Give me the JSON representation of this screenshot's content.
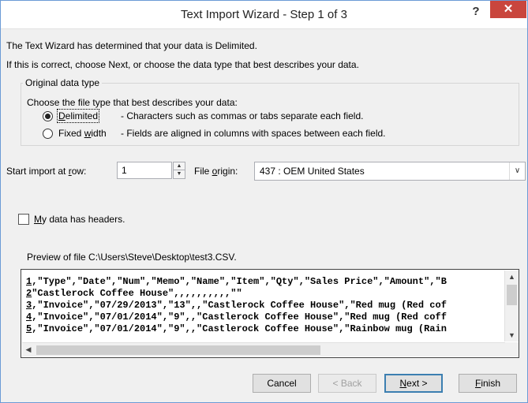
{
  "window": {
    "title": "Text Import Wizard - Step 1 of 3",
    "help_label": "?",
    "close_label": "✕"
  },
  "intro": {
    "line1": "The Text Wizard has determined that your data is Delimited.",
    "line2": "If this is correct, choose Next, or choose the data type that best describes your data."
  },
  "original_data_type": {
    "legend": "Original data type",
    "prompt": "Choose the file type that best describes your data:",
    "options": [
      {
        "label_pre": "",
        "label_key": "D",
        "label_post": "elimited",
        "description": "- Characters such as commas or tabs separate each field.",
        "checked": true
      },
      {
        "label_pre": "Fixed ",
        "label_key": "w",
        "label_post": "idth",
        "description": "- Fields are aligned in columns with spaces between each field.",
        "checked": false
      }
    ]
  },
  "start_import": {
    "label_pre": "Start import at ",
    "label_key": "r",
    "label_post": "ow:",
    "value": "1"
  },
  "file_origin": {
    "label_pre": "File ",
    "label_key": "o",
    "label_post": "rigin:",
    "value": "437 : OEM United States"
  },
  "headers_checkbox": {
    "label_key": "M",
    "label_post": "y data has headers.",
    "checked": false
  },
  "preview": {
    "label": "Preview of file C:\\Users\\Steve\\Desktop\\test3.CSV.",
    "rows": [
      {
        "num": "1",
        "text": ",\"Type\",\"Date\",\"Num\",\"Memo\",\"Name\",\"Item\",\"Qty\",\"Sales Price\",\"Amount\",\"B"
      },
      {
        "num": "2",
        "text": "\"Castlerock Coffee House\",,,,,,,,,,\"\""
      },
      {
        "num": "3",
        "text": ",\"Invoice\",\"07/29/2013\",\"13\",,\"Castlerock Coffee House\",\"Red mug (Red cof"
      },
      {
        "num": "4",
        "text": ",\"Invoice\",\"07/01/2014\",\"9\",,\"Castlerock Coffee House\",\"Red mug (Red coff"
      },
      {
        "num": "5",
        "text": ",\"Invoice\",\"07/01/2014\",\"9\",,\"Castlerock Coffee House\",\"Rainbow mug (Rain"
      }
    ]
  },
  "buttons": {
    "cancel": "Cancel",
    "back": "< Back",
    "next_key": "N",
    "next_post": "ext >",
    "finish_key": "F",
    "finish_post": "inish"
  },
  "colors": {
    "close_button": "#c9463d",
    "window_border": "#6b9bd6",
    "dialog_background": "#f0f0f0"
  }
}
